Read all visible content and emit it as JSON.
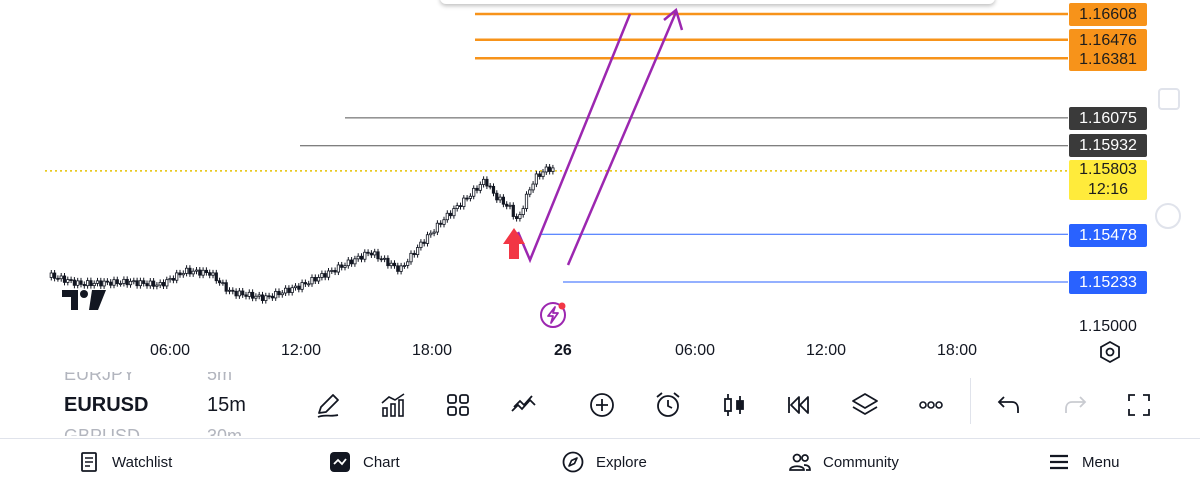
{
  "chart": {
    "logo_text": "TV",
    "price_axis_labels": [
      {
        "label": "1.16608",
        "price": 1.16608,
        "style": "orange"
      },
      {
        "label": "1.16476",
        "price": 1.16476,
        "style": "orange"
      },
      {
        "label": "1.16381",
        "price": 1.16381,
        "style": "orange"
      },
      {
        "label": "1.16075",
        "price": 1.16075,
        "style": "dark"
      },
      {
        "label": "1.15932",
        "price": 1.15932,
        "style": "dark"
      },
      {
        "label": "1.15478",
        "price": 1.15478,
        "style": "blue"
      },
      {
        "label": "1.15233",
        "price": 1.15233,
        "style": "blue"
      }
    ],
    "current_price": {
      "label": "1.15803",
      "countdown": "12:16"
    },
    "axis_bottom_price": "1.15000",
    "time_labels": [
      "06:00",
      "12:00",
      "18:00",
      "26",
      "06:00",
      "12:00",
      "18:00"
    ],
    "colors": {
      "orange": "#f7931a",
      "dark": "#3a3a3a",
      "blue": "#2962ff",
      "current": "#ffeb3b",
      "drawing": "#9c27b0",
      "arrow": "#f23645"
    }
  },
  "symbols": {
    "prev": {
      "symbol": "EURJPY",
      "timeframe": "5m"
    },
    "active": {
      "symbol": "EURUSD",
      "timeframe": "15m"
    },
    "next": {
      "symbol": "GBPUSD",
      "timeframe": "30m"
    }
  },
  "toolbar_icons": [
    "pencil-icon",
    "indicators-icon",
    "templates-icon",
    "drawing-tools-icon",
    "add-icon",
    "alarm-icon",
    "candle-type-icon",
    "replay-icon",
    "layers-icon",
    "more-icon",
    "undo-icon",
    "redo-icon",
    "fullscreen-icon"
  ],
  "nav": {
    "watchlist": "Watchlist",
    "chart": "Chart",
    "explore": "Explore",
    "community": "Community",
    "menu": "Menu"
  }
}
